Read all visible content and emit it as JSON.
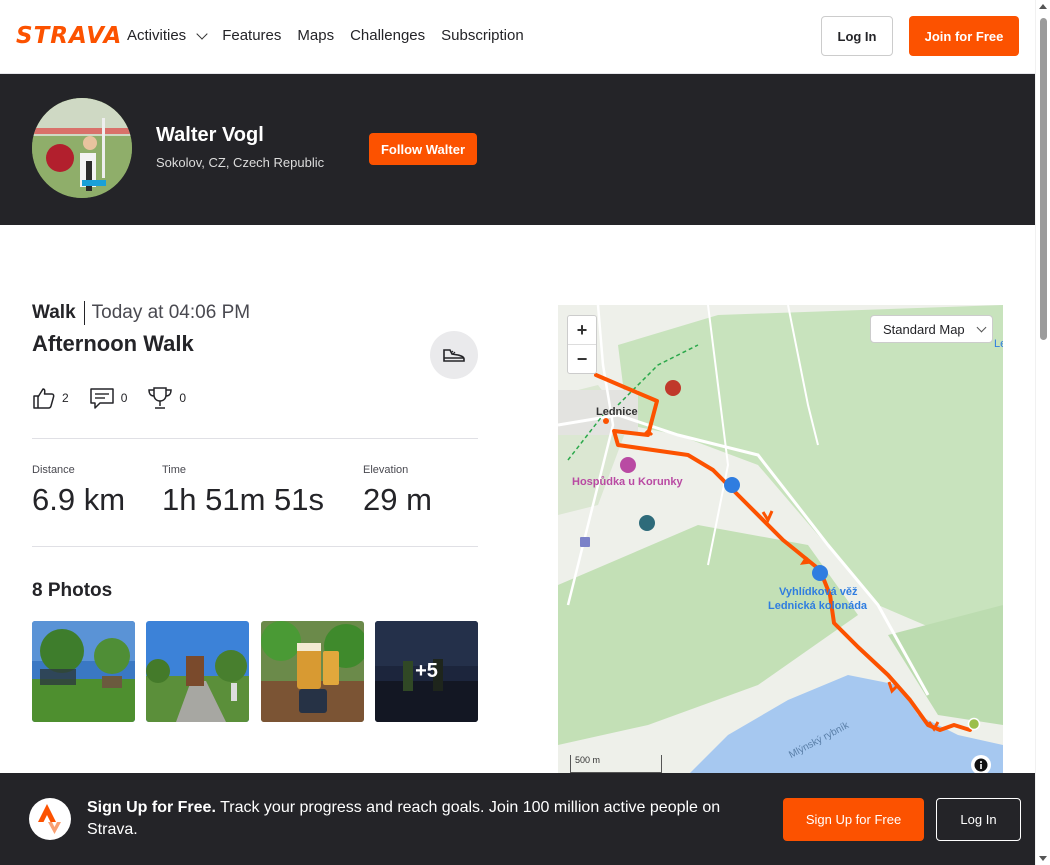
{
  "header": {
    "logo": "STRAVA",
    "nav": [
      {
        "label": "Activities",
        "has_menu": true
      },
      {
        "label": "Features"
      },
      {
        "label": "Maps"
      },
      {
        "label": "Challenges"
      },
      {
        "label": "Subscription"
      }
    ],
    "login_label": "Log In",
    "join_label": "Join for Free"
  },
  "athlete": {
    "name": "Walter Vogl",
    "location": "Sokolov, CZ, Czech Republic",
    "follow_label": "Follow Walter"
  },
  "activity": {
    "type": "Walk",
    "date": "Today at 04:06 PM",
    "title": "Afternoon Walk",
    "kudos": "2",
    "comments": "0",
    "achievements": "0",
    "stats": [
      {
        "label": "Distance",
        "value": "6.9 km"
      },
      {
        "label": "Time",
        "value": "1h 51m 51s"
      },
      {
        "label": "Elevation",
        "value": "29 m"
      }
    ]
  },
  "photos": {
    "title": "8 Photos",
    "more_label": "+5"
  },
  "map": {
    "style_label": "Standard Map",
    "zoom_in": "+",
    "zoom_out": "−",
    "scale_label": "500 m",
    "labels": {
      "lednice": "Lednice",
      "hospudka": "Hospůdka u Korunky",
      "vyhlidkova": "Vyhlídková věž",
      "kolonada": "Lednická kolonáda",
      "rybnik": "Mlýnský rybník",
      "edge": "Le"
    }
  },
  "signup_bar": {
    "headline": "Sign Up for Free.",
    "text": " Track your progress and reach goals. Join 100 million active people on Strava.",
    "signup_label": "Sign Up for Free",
    "login_label": "Log In"
  },
  "colors": {
    "brand": "#fc5200",
    "dark": "#242428",
    "route": "#fc5200",
    "water": "#a6c8f0",
    "park": "#bfe0b6"
  }
}
